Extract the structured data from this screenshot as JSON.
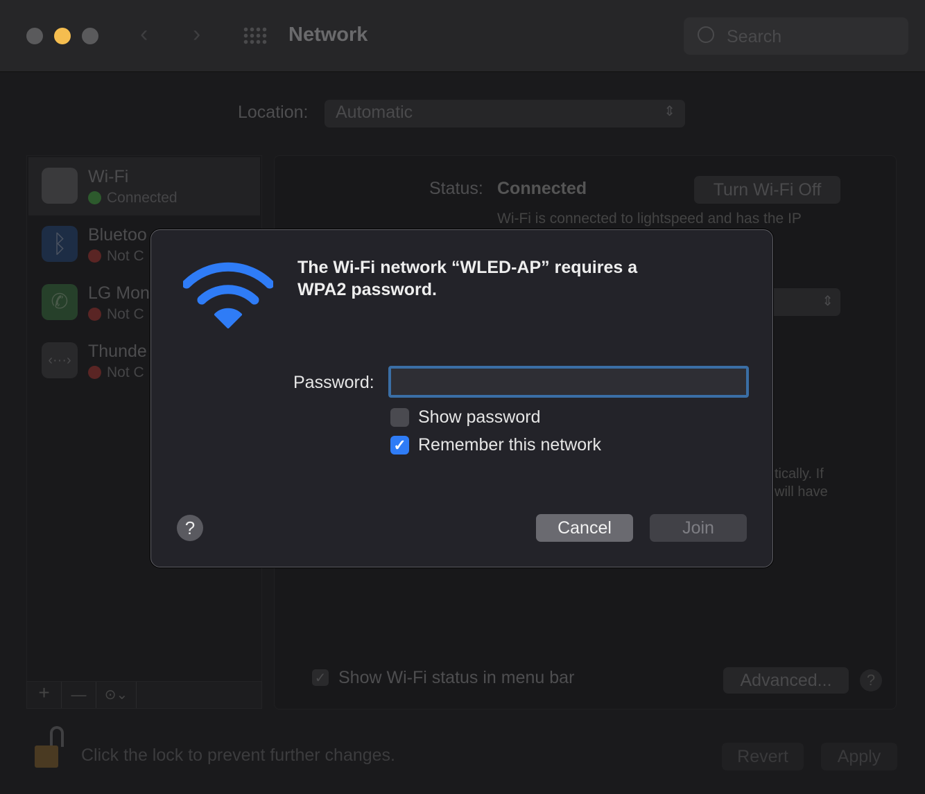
{
  "window": {
    "title": "Network",
    "search_placeholder": "Search"
  },
  "location": {
    "label": "Location:",
    "value": "Automatic"
  },
  "services": [
    {
      "name": "Wi-Fi",
      "status": "Connected",
      "status_color": "#2d5a2d",
      "icon": "wifi-icon"
    },
    {
      "name": "Bluetoo",
      "status": "Not C",
      "status_color": "#5a2524",
      "icon": "bluetooth-icon"
    },
    {
      "name": "LG Mon",
      "status": "Not C",
      "status_color": "#5a2524",
      "icon": "phone-icon"
    },
    {
      "name": "Thunde",
      "status": "Not C",
      "status_color": "#5a2524",
      "icon": "thunderbolt-icon"
    }
  ],
  "detail": {
    "status_label": "Status:",
    "status_value": "Connected",
    "turn_off": "Turn Wi-Fi Off",
    "desc": "Wi-Fi is connected to lightspeed and has the IP",
    "frag1": "tically. If",
    "frag2": "will have",
    "show_status": "Show Wi-Fi status in menu bar",
    "advanced": "Advanced...",
    "help": "?"
  },
  "footer": {
    "lock_text": "Click the lock to prevent further changes.",
    "revert": "Revert",
    "apply": "Apply",
    "add": "+",
    "remove": "—"
  },
  "dialog": {
    "title": "The Wi-Fi network “WLED-AP” requires a WPA2 password.",
    "password_label": "Password:",
    "password_value": "",
    "show_password": "Show password",
    "show_password_checked": false,
    "remember": "Remember this network",
    "remember_checked": true,
    "help": "?",
    "cancel": "Cancel",
    "join": "Join",
    "accent": "#2f7cf6"
  }
}
